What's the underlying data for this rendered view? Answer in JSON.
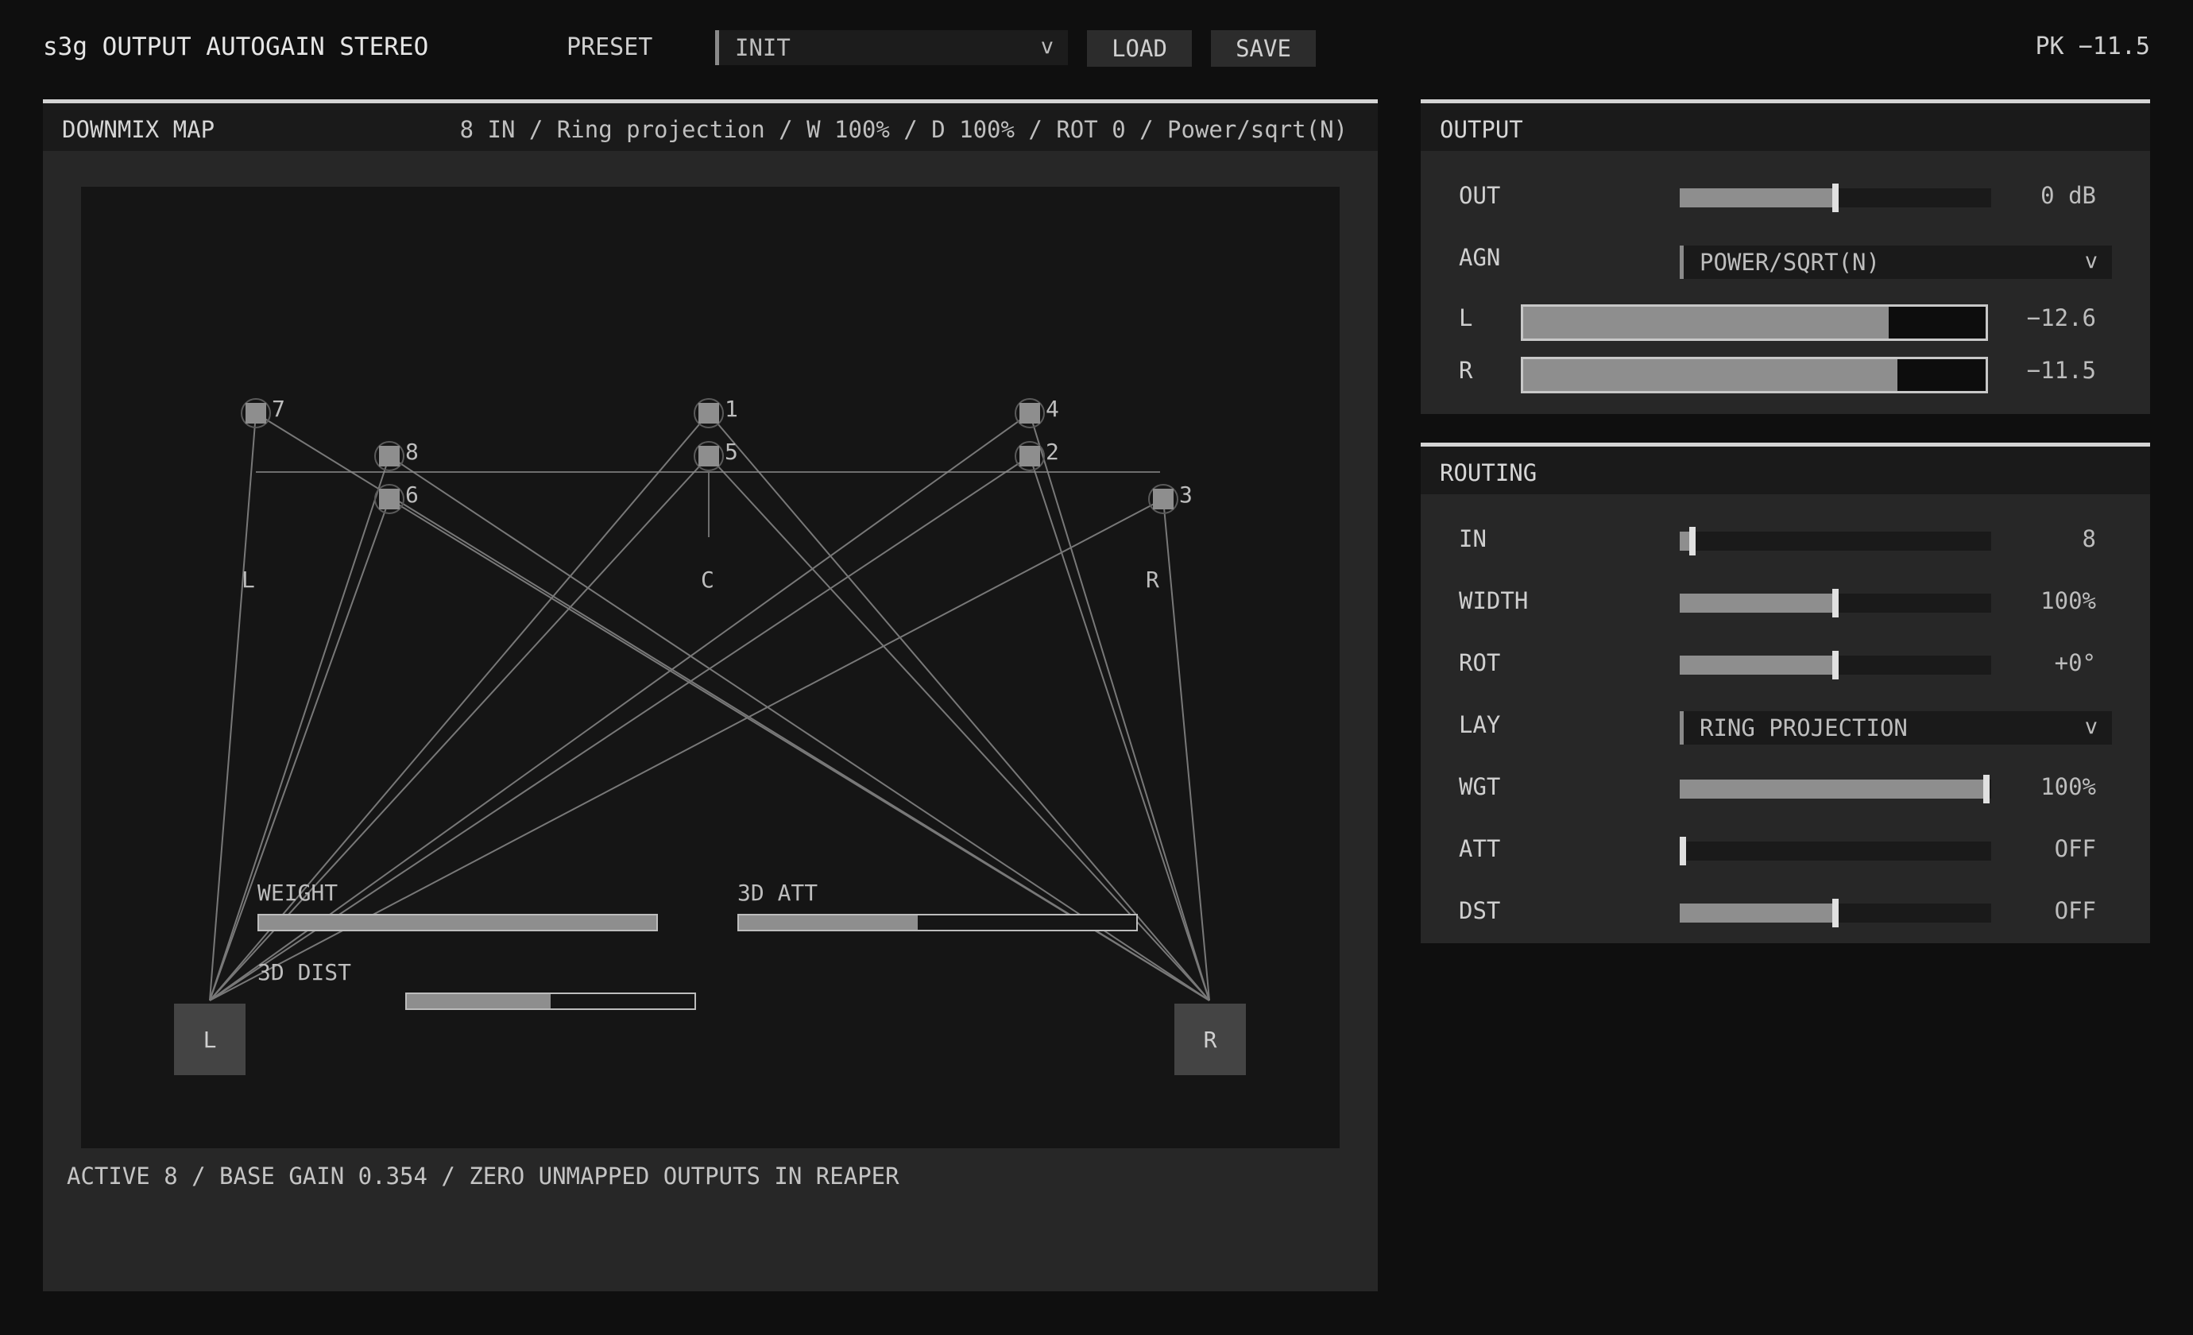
{
  "header": {
    "title": "s3g OUTPUT AUTOGAIN STEREO",
    "preset_label": "PRESET",
    "preset_value": "INIT",
    "caret": "v",
    "load_label": "LOAD",
    "save_label": "SAVE",
    "peak": "PK −11.5"
  },
  "downmix": {
    "title": "DOWNMIX MAP",
    "summary": "8 IN / Ring projection / W 100% / D 100% / ROT 0 / Power/sqrt(N)",
    "labels": {
      "left": "L",
      "center": "C",
      "right": "R"
    },
    "inputs": [
      "1",
      "2",
      "3",
      "4",
      "5",
      "6",
      "7",
      "8"
    ],
    "speakers": {
      "left": "L",
      "right": "R"
    },
    "weight": {
      "label": "WEIGHT",
      "level": 1.0
    },
    "att3d": {
      "label": "3D ATT",
      "level": 0.45
    },
    "dist3d": {
      "label": "3D DIST",
      "level": 0.5
    },
    "footer": "ACTIVE 8 / BASE GAIN 0.354 / ZERO UNMAPPED OUTPUTS IN REAPER"
  },
  "output": {
    "title": "OUTPUT",
    "out": {
      "label": "OUT",
      "value": "0 dB",
      "level": 0.5
    },
    "agn": {
      "label": "AGN",
      "value": "POWER/SQRT(N)",
      "caret": "v"
    },
    "meter_l": {
      "label": "L",
      "value": "−12.6",
      "level": 0.79
    },
    "meter_r": {
      "label": "R",
      "value": "−11.5",
      "level": 0.81
    }
  },
  "routing": {
    "title": "ROUTING",
    "in": {
      "label": "IN",
      "value": "8",
      "level": 0.04
    },
    "width": {
      "label": "WIDTH",
      "value": "100%",
      "level": 0.5
    },
    "rot": {
      "label": "ROT",
      "value": "+0°",
      "level": 0.5
    },
    "lay": {
      "label": "LAY",
      "value": "RING PROJECTION",
      "caret": "v"
    },
    "wgt": {
      "label": "WGT",
      "value": "100%",
      "level": 0.985
    },
    "att": {
      "label": "ATT",
      "value": "OFF",
      "level": 0.01
    },
    "dst": {
      "label": "DST",
      "value": "OFF",
      "level": 0.5
    }
  }
}
